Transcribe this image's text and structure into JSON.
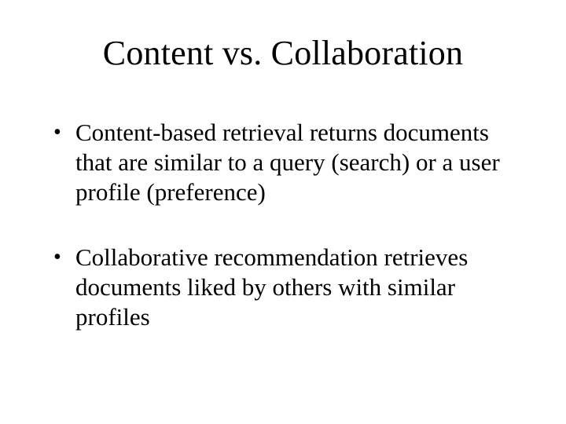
{
  "slide": {
    "title": "Content vs. Collaboration",
    "bullets": [
      "Content-based retrieval returns documents that are similar to a query (search) or a user profile (preference)",
      "Collaborative recommendation retrieves documents liked by others with similar profiles"
    ]
  }
}
